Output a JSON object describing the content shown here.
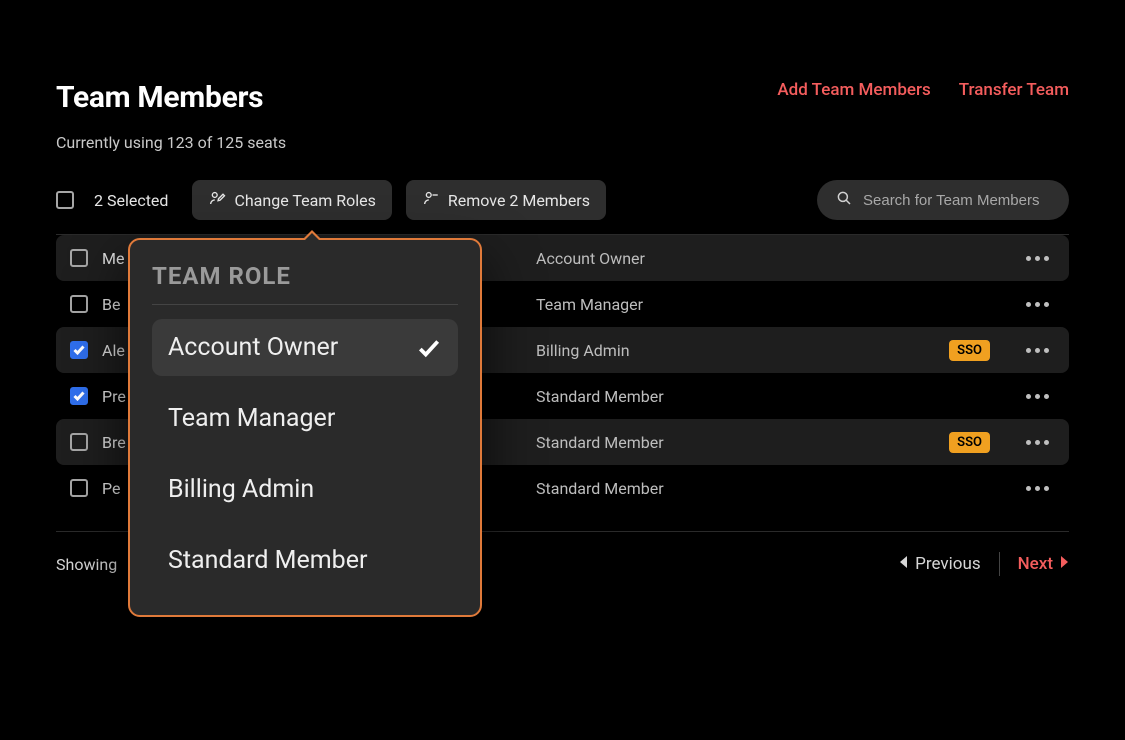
{
  "header": {
    "title": "Team Members",
    "subtitle": "Currently using 123 of 125 seats",
    "add_label": "Add Team Members",
    "transfer_label": "Transfer Team"
  },
  "toolbar": {
    "selected_label": "2 Selected",
    "change_roles_label": "Change Team Roles",
    "remove_label": "Remove 2 Members"
  },
  "search": {
    "placeholder": "Search for Team Members"
  },
  "rows": [
    {
      "name": "Me",
      "role": "Account Owner",
      "checked": false,
      "sso": false
    },
    {
      "name": "Be",
      "role": "Team Manager",
      "checked": false,
      "sso": false
    },
    {
      "name": "Ale",
      "role": "Billing Admin",
      "checked": true,
      "sso": true
    },
    {
      "name": "Pre",
      "role": "Standard Member",
      "checked": true,
      "sso": false
    },
    {
      "name": "Bre",
      "role": "Standard Member",
      "checked": false,
      "sso": true
    },
    {
      "name": "Pe",
      "role": "Standard Member",
      "checked": false,
      "sso": false
    }
  ],
  "sso_badge": "SSO",
  "footer": {
    "showing": "Showing",
    "previous": "Previous",
    "next": "Next"
  },
  "dropdown": {
    "title": "TEAM ROLE",
    "items": [
      {
        "label": "Account Owner",
        "selected": true
      },
      {
        "label": "Team Manager",
        "selected": false
      },
      {
        "label": "Billing Admin",
        "selected": false
      },
      {
        "label": "Standard Member",
        "selected": false
      }
    ]
  }
}
